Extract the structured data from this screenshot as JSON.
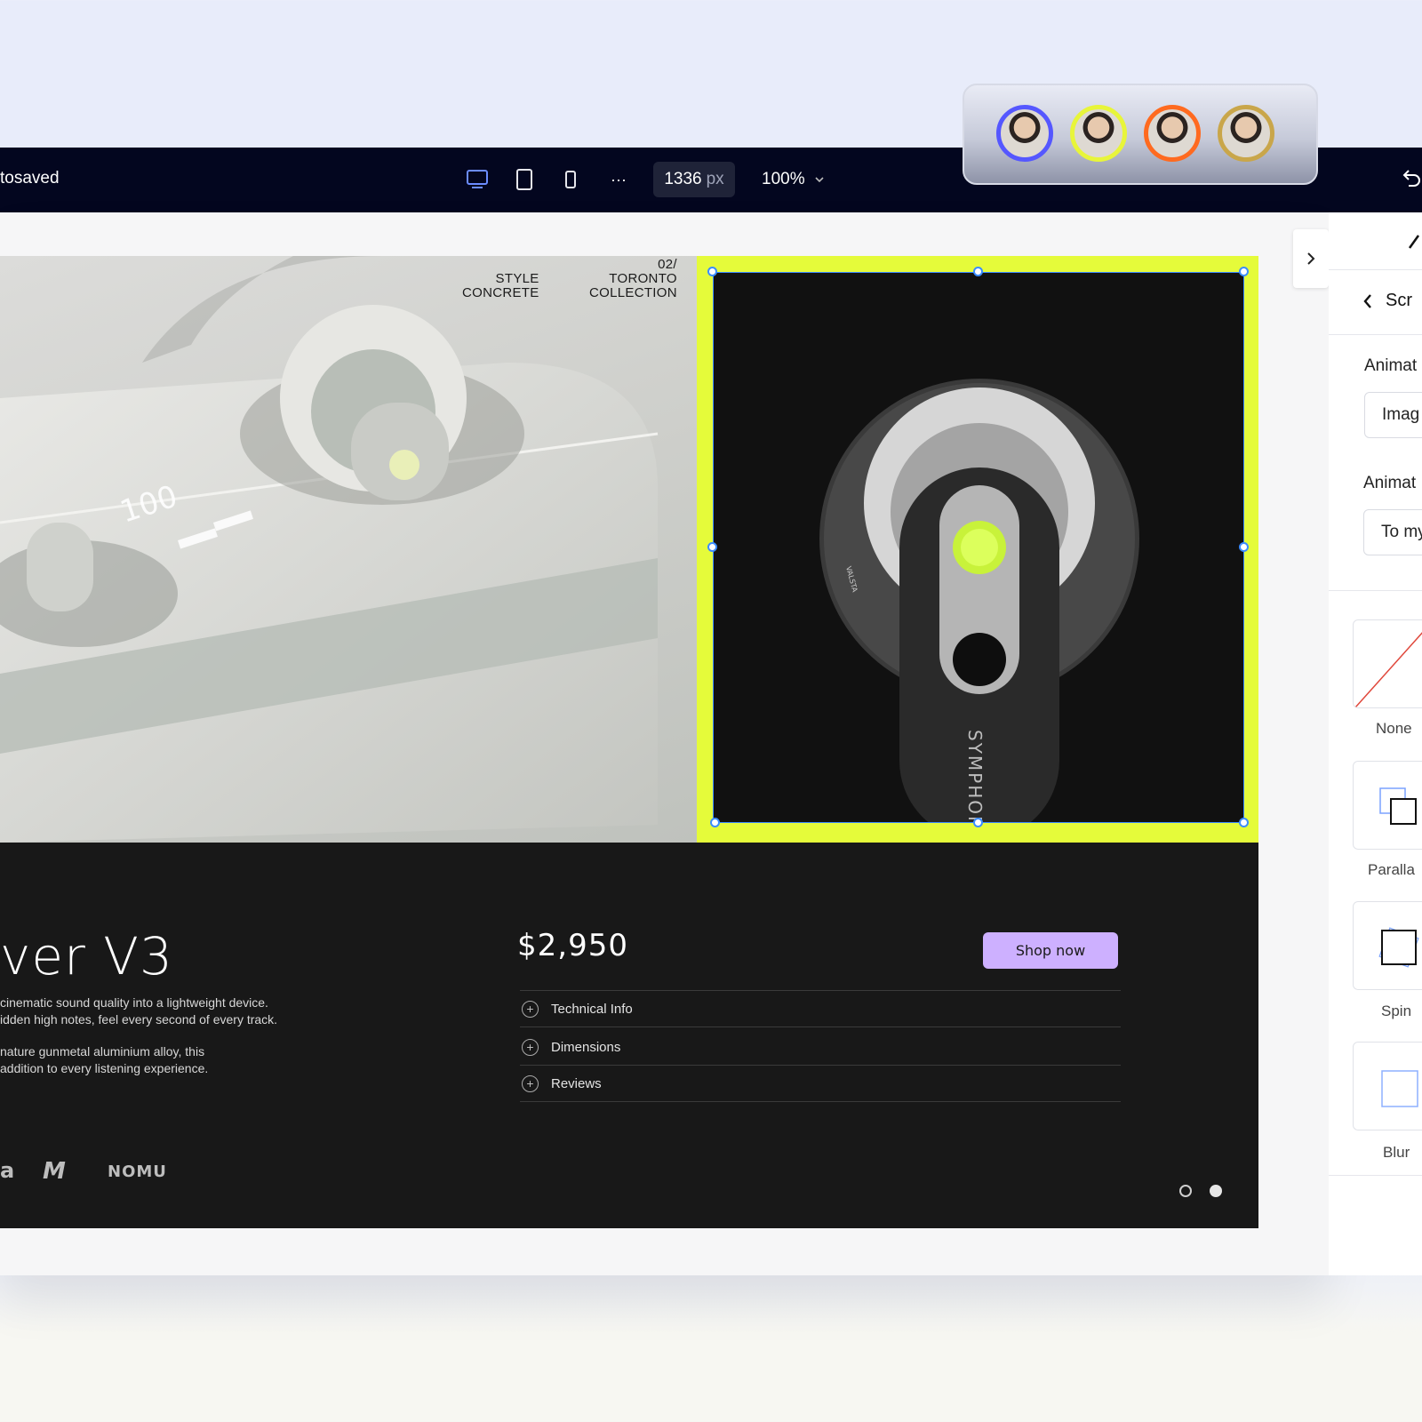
{
  "toolbar": {
    "status": "tosaved",
    "width_value": "1336",
    "width_unit": "px",
    "zoom": "100%",
    "more": "···"
  },
  "collaborators": [
    {
      "ring": "#5557ff"
    },
    {
      "ring": "#e8f53a"
    },
    {
      "ring": "#ff6a1f"
    },
    {
      "ring": "#c9a64a"
    }
  ],
  "hero": {
    "style_line1": "STYLE",
    "style_line2": "CONCRETE",
    "collection_line1": "02/",
    "collection_line2": "TORONTO",
    "collection_line3": "COLLECTION",
    "screen_number": "100",
    "product_brand_vertical": "SYMPHON",
    "small_brand": "VALSTA"
  },
  "product": {
    "title": "ver V3",
    "desc1_line1": "cinematic sound quality into a lightweight device.",
    "desc1_line2": "idden high notes, feel every second of every track.",
    "desc2_line1": "nature gunmetal  aluminium alloy, this",
    "desc2_line2": "addition to every listening experience.",
    "price": "$2,950",
    "cta": "Shop now",
    "accordion": [
      "Technical Info",
      "Dimensions",
      "Reviews"
    ],
    "brands": [
      "a",
      "M",
      "NOMU"
    ]
  },
  "panel": {
    "heading": "Scr",
    "label1": "Animat",
    "field1": "Imag",
    "label2": "Animat",
    "field2": "To my",
    "effects": [
      "None",
      "Paralla",
      "Spin",
      "Blur"
    ]
  },
  "colors": {
    "toolbar_bg": "#03061f",
    "selection_highlight": "#e5fb3a",
    "selection_outline": "#3b8cff",
    "cta_bg": "#cdb0ff",
    "info_bg": "#181818"
  }
}
